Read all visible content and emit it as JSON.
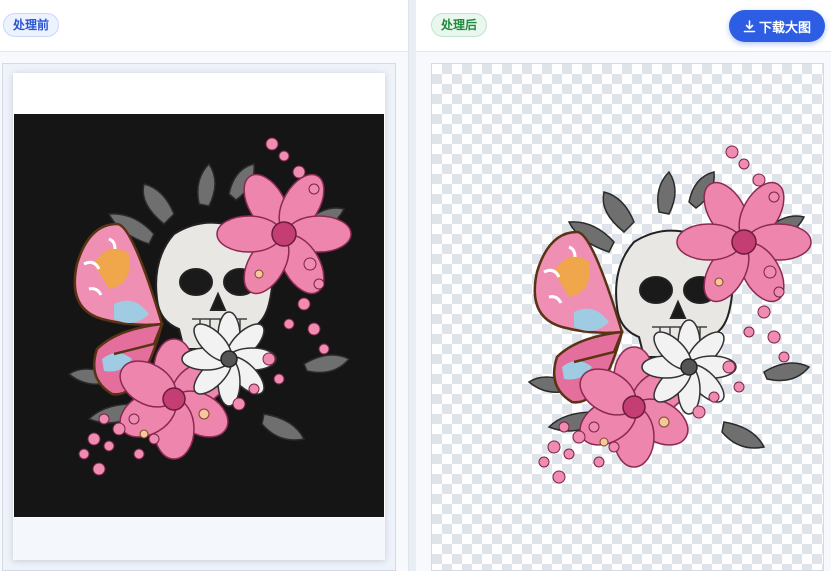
{
  "before_panel": {
    "label": "处理前",
    "label_color": "#2c55d4",
    "photo_background": "#151515"
  },
  "after_panel": {
    "label": "处理后",
    "label_color": "#1f8a3f",
    "download_label": "下载大图",
    "download_icon": "download-icon",
    "button_color": "#2c5de3",
    "background": "transparent-checkerboard"
  },
  "artwork": {
    "subject": "skull-butterfly-flowers-illustration",
    "flower_pink": "#e66a9a",
    "butterfly_colors": [
      "#e6759f",
      "#f0a64a",
      "#9fcbe3"
    ]
  }
}
